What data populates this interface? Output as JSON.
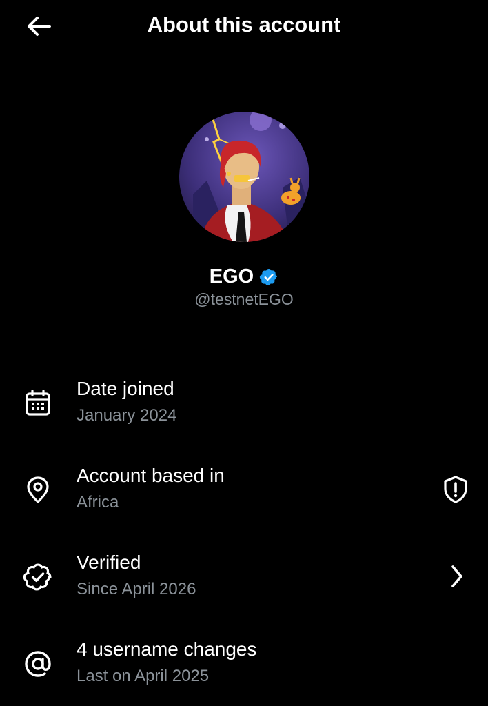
{
  "header": {
    "title": "About this account",
    "back_icon": "arrow-left-icon"
  },
  "profile": {
    "display_name": "EGO",
    "handle": "@testnetEGO",
    "verified_badge_color": "#1d9bf0",
    "avatar_description_icon": "avatar"
  },
  "rows": [
    {
      "icon": "calendar-icon",
      "title": "Date joined",
      "subtitle": "January 2024"
    },
    {
      "icon": "location-pin-icon",
      "title": "Account based in",
      "subtitle": "Africa",
      "right_icon": "shield-alert-icon"
    },
    {
      "icon": "verified-check-icon",
      "title": "Verified",
      "subtitle": "Since April 2026",
      "right_icon": "chevron-right-icon"
    },
    {
      "icon": "at-sign-icon",
      "title": "4 username changes",
      "subtitle": "Last on April 2025"
    }
  ],
  "colors": {
    "background": "#000000",
    "primary_text": "#ffffff",
    "secondary_text": "#8b9299",
    "accent": "#1d9bf0"
  }
}
